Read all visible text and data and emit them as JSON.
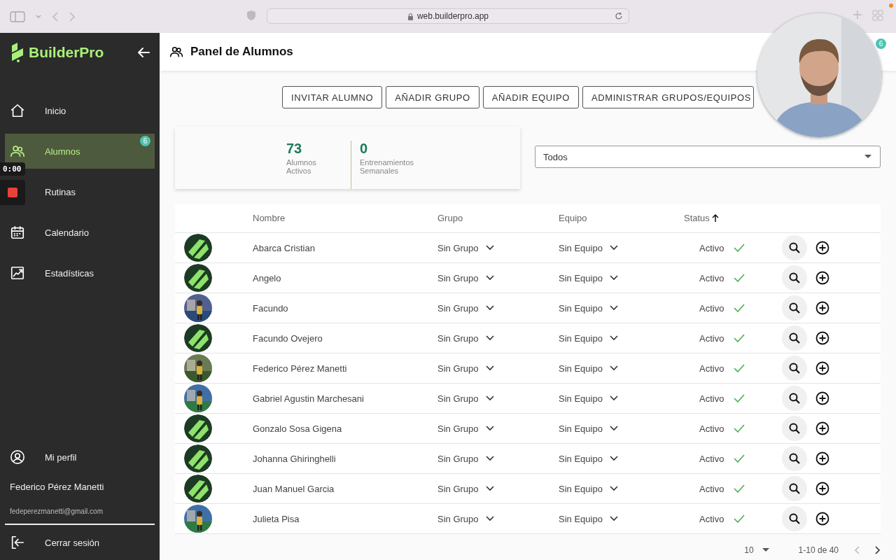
{
  "browser": {
    "url": "web.builderpro.app"
  },
  "sidebar": {
    "brand": "BuilderPro",
    "nav": [
      {
        "label": "Inicio",
        "selected": false
      },
      {
        "label": "Alumnos",
        "selected": true,
        "badge": "6"
      },
      {
        "label": "Rutinas",
        "selected": false
      },
      {
        "label": "Calendario",
        "selected": false
      },
      {
        "label": "Estadísticas",
        "selected": false
      }
    ],
    "profile": "Mi perfil",
    "user_name": "Federico Pérez Manetti",
    "user_email": "fedeperezmanetti@gmail.com",
    "logout": "Cerrar sesión"
  },
  "recorder": {
    "time": "0:00"
  },
  "header": {
    "title": "Panel de Alumnos",
    "badge": "6"
  },
  "actions": [
    "INVITAR ALUMNO",
    "AÑADIR GRUPO",
    "AÑADIR EQUIPO",
    "ADMINISTRAR GRUPOS/EQUIPOS"
  ],
  "stats": [
    {
      "value": "73",
      "label": "Alumnos Activos"
    },
    {
      "value": "0",
      "label": "Entrenamientos Semanales"
    }
  ],
  "filter": {
    "value": "Todos"
  },
  "table": {
    "columns": [
      {
        "label": "Nombre",
        "sorted": false
      },
      {
        "label": "Grupo",
        "sorted": false
      },
      {
        "label": "Equipo",
        "sorted": false
      },
      {
        "label": "Status",
        "sorted": true
      }
    ],
    "rows": [
      {
        "kind": "logo",
        "name": "Abarca Cristian",
        "group": "Sin Grupo",
        "team": "Sin Equipo",
        "status": "Activo",
        "active": true
      },
      {
        "kind": "logo",
        "name": "Angelo",
        "group": "Sin Grupo",
        "team": "Sin Equipo",
        "status": "Activo",
        "active": true
      },
      {
        "kind": "picture",
        "name": "Facundo",
        "group": "Sin Grupo",
        "team": "Sin Equipo",
        "status": "Activo",
        "active": true
      },
      {
        "kind": "logo",
        "name": "Facundo Ovejero",
        "group": "Sin Grupo",
        "team": "Sin Equipo",
        "status": "Activo",
        "active": true
      },
      {
        "kind": "picture",
        "name": "Federico Pérez Manetti",
        "group": "Sin Grupo",
        "team": "Sin Equipo",
        "status": "Activo",
        "active": true
      },
      {
        "kind": "picture",
        "name": "Gabriel Agustin Marchesani",
        "group": "Sin Grupo",
        "team": "Sin Equipo",
        "status": "Activo",
        "active": true
      },
      {
        "kind": "logo",
        "name": "Gonzalo Sosa Gigena",
        "group": "Sin Grupo",
        "team": "Sin Equipo",
        "status": "Activo",
        "active": true
      },
      {
        "kind": "logo",
        "name": "Johanna Ghiringhelli",
        "group": "Sin Grupo",
        "team": "Sin Equipo",
        "status": "Activo",
        "active": true
      },
      {
        "kind": "logo",
        "name": "Juan Manuel Garcia",
        "group": "Sin Grupo",
        "team": "Sin Equipo",
        "status": "Activo",
        "active": true
      },
      {
        "kind": "picture",
        "name": "Julieta Pisa",
        "group": "Sin Grupo",
        "team": "Sin Equipo",
        "status": "Activo",
        "active": true
      }
    ]
  },
  "pagination": {
    "page_size": "10",
    "range": "1-10 de 40"
  },
  "webcam": {
    "kind": "picture"
  }
}
